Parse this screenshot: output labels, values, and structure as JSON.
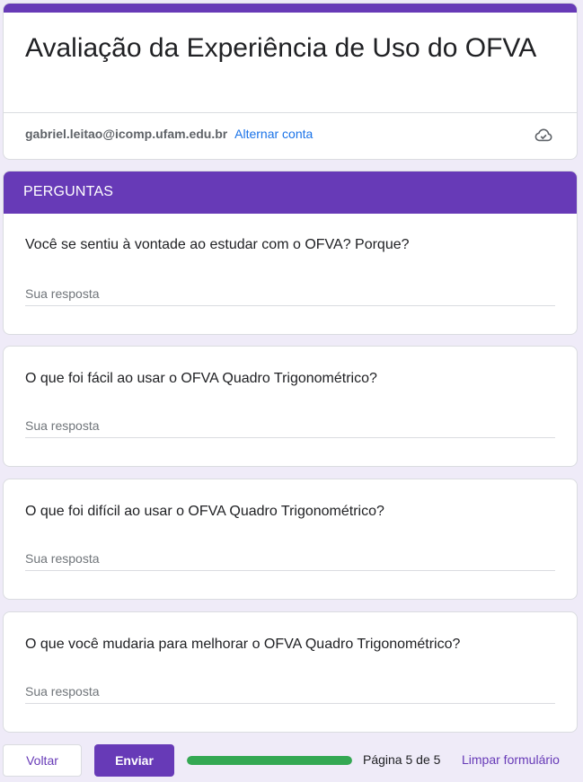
{
  "header": {
    "title": "Avaliação da Experiência de Uso do OFVA",
    "account_email": "gabriel.leitao@icomp.ufam.edu.br",
    "switch_account_label": "Alternar conta",
    "cloud_icon": "cloud-check-icon"
  },
  "section": {
    "title": "PERGUNTAS"
  },
  "questions": [
    {
      "title": "Você se sentiu à vontade ao estudar com o OFVA? Porque?",
      "placeholder": "Sua resposta",
      "value": ""
    },
    {
      "title": "O que foi fácil ao usar o OFVA Quadro Trigonométrico?",
      "placeholder": "Sua resposta",
      "value": ""
    },
    {
      "title": "O que foi difícil ao usar o OFVA Quadro Trigonométrico?",
      "placeholder": "Sua resposta",
      "value": ""
    },
    {
      "title": "O que você mudaria para melhorar o OFVA Quadro Trigonométrico?",
      "placeholder": "Sua resposta",
      "value": ""
    }
  ],
  "footer": {
    "back_label": "Voltar",
    "submit_label": "Enviar",
    "progress_fraction": 1.0,
    "page_indicator": "Página 5 de 5",
    "clear_label": "Limpar formulário"
  },
  "colors": {
    "accent": "#673ab7",
    "progress": "#34a853",
    "link": "#1a73e8",
    "background": "#efebf8"
  }
}
